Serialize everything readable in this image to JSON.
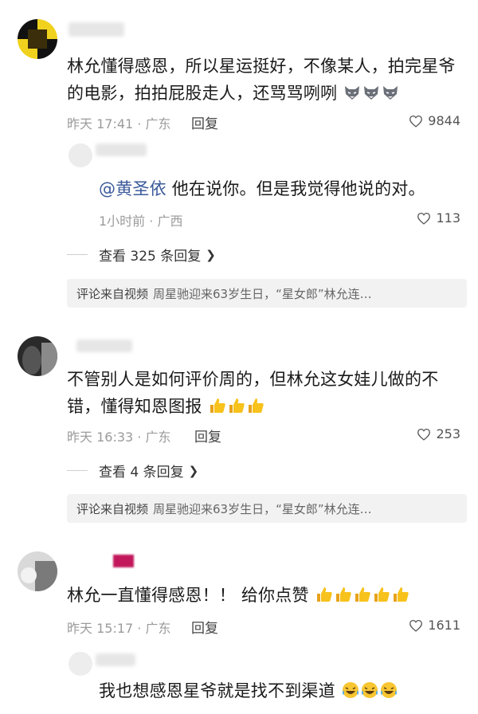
{
  "comments": [
    {
      "text": "林允懂得感恩，所以星运挺好，不像某人，拍完星爷的电影，拍拍屁股走人，还骂骂咧咧",
      "trailing_emoji": "wolf-face-emoji x3",
      "time": "昨天 17:41 · 广东",
      "reply_label": "回复",
      "likes": "9844",
      "reply": {
        "mention": "@黄圣依",
        "text": " 他在说你。但是我觉得他说的对。",
        "time": "1小时前 · 广西",
        "likes": "113"
      },
      "view_replies": "查看 325 条回复",
      "from_video": {
        "label": "评论来自视频",
        "title": "周星驰迎来63岁生日，“星女郎”林允连…"
      }
    },
    {
      "text": "不管别人是如何评价周的，但林允这女娃儿做的不错，懂得知恩图报",
      "trailing_emoji": "thumbs-up-emoji x3",
      "time": "昨天 16:33 · 广东",
      "reply_label": "回复",
      "likes": "253",
      "view_replies": "查看 4 条回复",
      "from_video": {
        "label": "评论来自视频",
        "title": "周星驰迎来63岁生日，“星女郎”林允连…"
      }
    },
    {
      "text": "林允一直懂得感恩！！ 给你点赞",
      "trailing_emoji": "thumbs-up-emoji x5",
      "time": "昨天 15:17 · 广东",
      "reply_label": "回复",
      "likes": "1611",
      "reply": {
        "text": "我也想感恩星爷就是找不到渠道",
        "trailing_emoji": "laughing-crying-emoji x3"
      }
    }
  ],
  "colors": {
    "mention": "#3b5a9b",
    "meta": "#9b9b9b",
    "from_video_bg": "#f2f2f2"
  }
}
